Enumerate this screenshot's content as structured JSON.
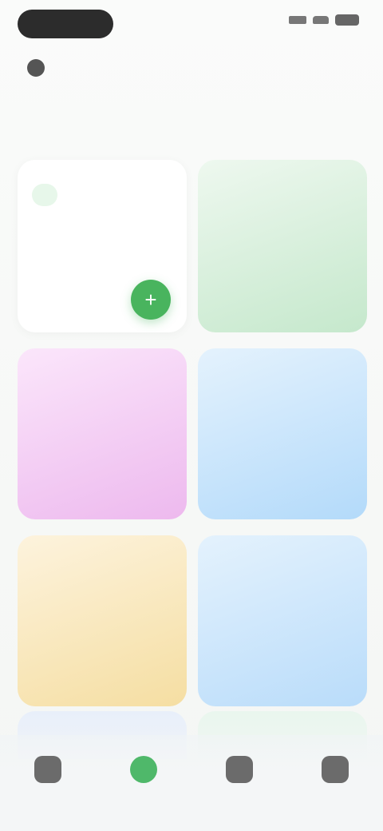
{
  "status_bar": {
    "pill_text": "",
    "signal_icon": "signal-icon",
    "wifi_icon": "wifi-icon",
    "battery_icon": "battery-icon"
  },
  "header": {
    "user_label": "",
    "link_label": ""
  },
  "page_title": "",
  "info_tile": {
    "badge": "",
    "subtitle": "",
    "fab_icon": "plus-icon"
  },
  "tiles": [
    {
      "label": "",
      "color": "#c5e8cc"
    },
    {
      "label": "",
      "color": "#edb9ee"
    },
    {
      "label": "",
      "color": "#b3dafa"
    },
    {
      "label": "",
      "color": "#f5dea2"
    },
    {
      "label": "",
      "color": "#b9dcfa"
    }
  ],
  "bottom_nav": [
    {
      "icon": "home-icon",
      "label": ""
    },
    {
      "icon": "chat-icon",
      "label": ""
    },
    {
      "icon": "calendar-icon",
      "label": ""
    },
    {
      "icon": "profile-icon",
      "label": ""
    }
  ],
  "colors": {
    "accent": "#49b45e",
    "text": "#444444"
  }
}
